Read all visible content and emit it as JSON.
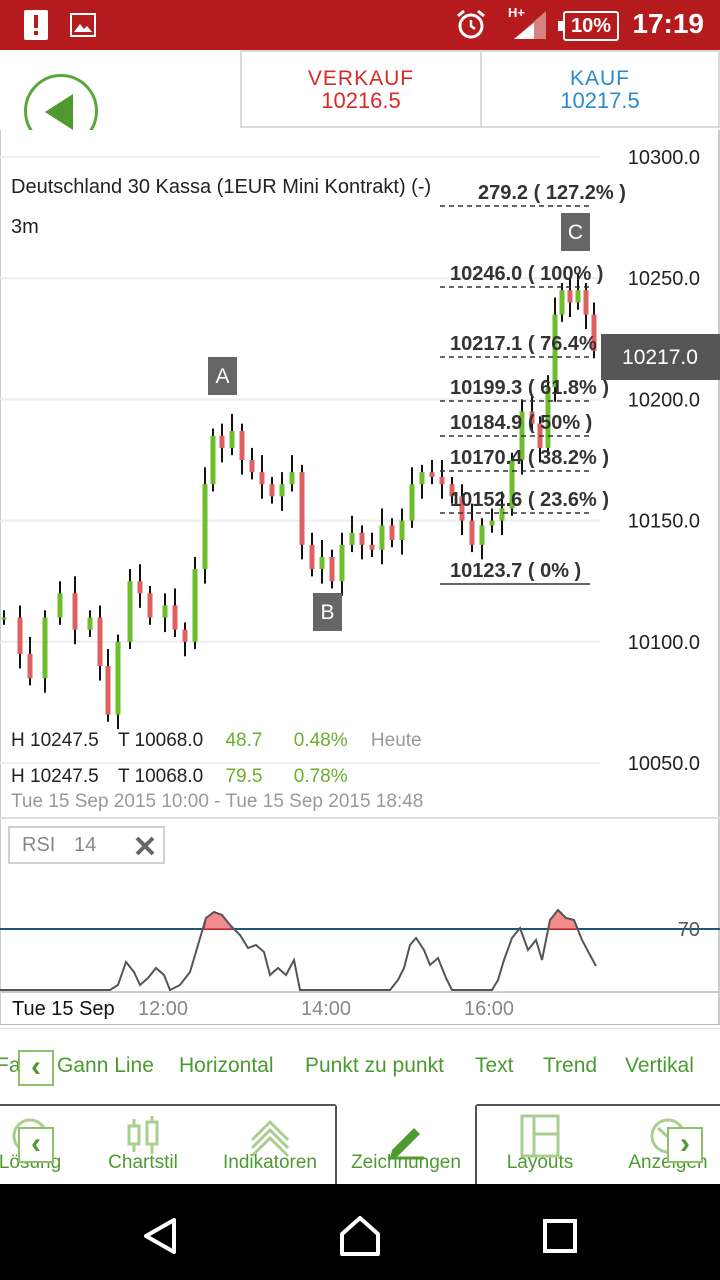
{
  "statusbar": {
    "battery": "10%",
    "time": "17:19",
    "network": "H+"
  },
  "header": {
    "sell_label": "VERKAUF",
    "sell_value": "10216.5",
    "buy_label": "KAUF",
    "buy_value": "10217.5"
  },
  "chart": {
    "title": "Deutschland 30 Kassa (1EUR Mini Kontrakt) (-)",
    "interval": "3m",
    "y_ticks": [
      "10300.0",
      "10250.0",
      "10200.0",
      "10150.0",
      "10100.0",
      "10050.0"
    ],
    "current_price": "10217.0",
    "point_labels": [
      "A",
      "B",
      "C"
    ],
    "fib_levels": [
      "279.2 ( 127.2% )",
      "10246.0 ( 100% )",
      "10217.1 ( 76.4%",
      "10199.3 ( 61.8% )",
      "10184.9 ( 50% )",
      "10170.4 ( 38.2% )",
      "10152.6 ( 23.6% )",
      "10123.7 ( 0% )"
    ],
    "stats": [
      {
        "high": "H 10247.5",
        "low": "T 10068.0",
        "change": "48.7",
        "pct": "0.48%",
        "period": "Heute"
      },
      {
        "high": "H 10247.5",
        "low": "T 10068.0",
        "change": "79.5",
        "pct": "0.78%"
      }
    ],
    "range": "Tue 15 Sep 2015 10:00 - Tue 15 Sep 2015 18:48",
    "x_ticks": [
      "Tue 15 Sep",
      "12:00",
      "14:00",
      "16:00"
    ]
  },
  "rsi": {
    "label": "RSI",
    "period": "14",
    "level": "70"
  },
  "drawing_tools": [
    "Fa",
    "Gann Line",
    "Horizontal",
    "Punkt zu punkt",
    "Text",
    "Trend",
    "Vertikal"
  ],
  "tabs": [
    "Lösung",
    "Chartstil",
    "Indikatoren",
    "Zeichnungen",
    "Layouts",
    "Anzeigen"
  ],
  "colors": {
    "brand_red": "#b51a1d",
    "accent_green": "#4e9a31",
    "sell_red": "#d92a26",
    "buy_blue": "#2a8bd0"
  }
}
